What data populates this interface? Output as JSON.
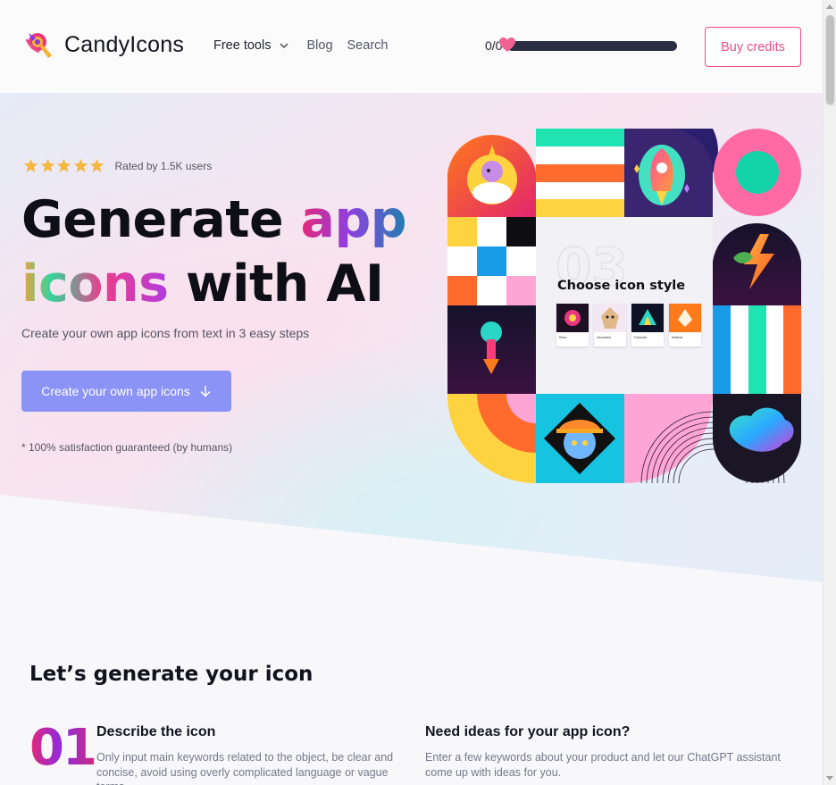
{
  "header": {
    "brand": "CandyIcons",
    "nav": {
      "free_tools": "Free tools",
      "blog": "Blog",
      "search": "Search"
    },
    "credits": {
      "count": "0/0",
      "progress": 0
    },
    "buy_button": "Buy credits"
  },
  "hero": {
    "rating_stars": 5,
    "rating_text": "Rated by 1.5K users",
    "headline": {
      "part1": "Generate ",
      "part2": "app",
      "part3": "icons",
      "part4": " with AI"
    },
    "subtitle": "Create your own app icons from text in 3 easy steps",
    "cta_label": "Create your own app icons",
    "guarantee": "* 100% satisfaction guaranteed (by humans)"
  },
  "showcase": {
    "card_number": "03",
    "card_title": "Choose icon style",
    "styles": [
      "Retro",
      "Geometric",
      "Futuristic",
      "Minimal"
    ]
  },
  "steps": {
    "section_title": "Let’s generate your icon",
    "step1": {
      "number": "01",
      "title": "Describe the icon",
      "description": "Only input main keywords related to the object, be clear and concise, avoid using overly complicated language or vague terms."
    },
    "ideas": {
      "title": "Need ideas for your app icon?",
      "description": "Enter a few keywords about your product and let our ChatGPT assistant come up with ideas for you."
    }
  },
  "colors": {
    "accent_pink": "#ec4d86",
    "cta_purple": "#8b93f7",
    "dark_navy": "#2b2d42"
  }
}
